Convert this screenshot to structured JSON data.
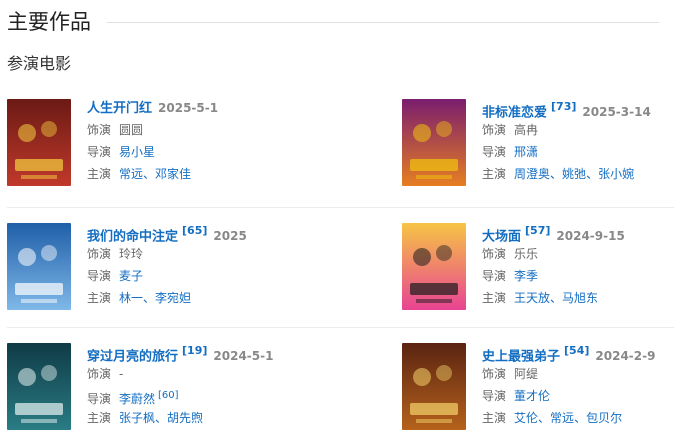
{
  "section_title": "主要作品",
  "sub_title": "参演电影",
  "labels": {
    "role": "饰演",
    "director": "导演",
    "cast": "主演"
  },
  "films": [
    {
      "title": "人生开门红",
      "ref": "",
      "date": "2025-5-1",
      "role": "圆圆",
      "director": [
        "易小星"
      ],
      "director_ref": "",
      "cast": [
        "常远",
        "邓家佳"
      ]
    },
    {
      "title": "非标准恋爱",
      "ref": "[73]",
      "date": "2025-3-14",
      "role": "高冉",
      "director": [
        "邢潇"
      ],
      "director_ref": "",
      "cast": [
        "周澄奥",
        "姚弛",
        "张小婉"
      ]
    },
    {
      "title": "我们的命中注定",
      "ref": "[65]",
      "date": "2025",
      "role": "玲玲",
      "director": [
        "麦子"
      ],
      "director_ref": "",
      "cast": [
        "林一",
        "李宛妲"
      ]
    },
    {
      "title": "大场面",
      "ref": "[57]",
      "date": "2024-9-15",
      "role": "乐乐",
      "director": [
        "李季"
      ],
      "director_ref": "",
      "cast": [
        "王天放",
        "马旭东"
      ]
    },
    {
      "title": "穿过月亮的旅行",
      "ref": "[19]",
      "date": "2024-5-1",
      "role": "-",
      "director": [
        "李蔚然"
      ],
      "director_ref": "[60]",
      "cast": [
        "张子枫",
        "胡先煦"
      ]
    },
    {
      "title": "史上最强弟子",
      "ref": "[54]",
      "date": "2024-2-9",
      "role": "阿缇",
      "director": [
        "董才伦"
      ],
      "director_ref": "",
      "cast": [
        "艾伦",
        "常远",
        "包贝尔"
      ]
    }
  ],
  "poster_icons": [
    "movie-poster-icon",
    "movie-poster-icon",
    "movie-poster-icon",
    "movie-poster-icon",
    "movie-poster-icon",
    "movie-poster-icon"
  ]
}
